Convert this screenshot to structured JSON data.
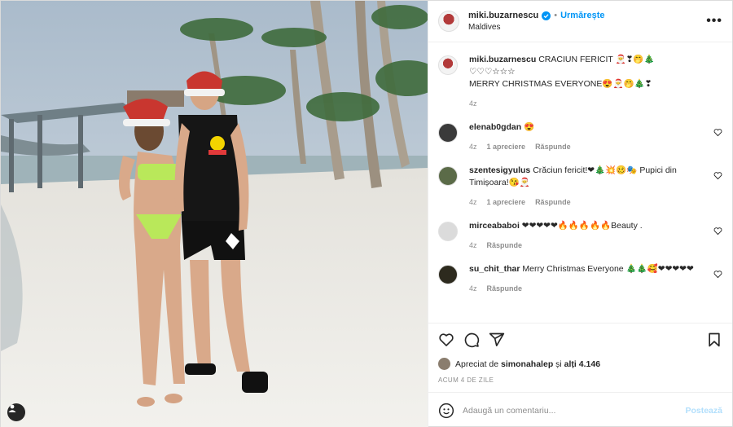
{
  "header": {
    "username": "miki.buzarnescu",
    "follow_label": "Urmărește",
    "location": "Maldives",
    "more_glyph": "•••"
  },
  "caption": {
    "username": "miki.buzarnescu",
    "line1": "CRACIUN FERICIT 🎅❣🤭🎄",
    "line2": "♡♡♡☆☆☆",
    "line3": "MERRY CHRISTMAS EVERYONE😍🎅🤭🎄❣",
    "time": "4z"
  },
  "comments": [
    {
      "username": "elenab0gdan",
      "text": "😍",
      "time": "4z",
      "likes": "1 apreciere",
      "reply": "Răspunde"
    },
    {
      "username": "szentesigyulus",
      "text": "Crăciun fericit!❤🎄💥🥴🎭 Pupici din Timișoara!😘🎅",
      "time": "4z",
      "likes": "1 apreciere",
      "reply": "Răspunde"
    },
    {
      "username": "mirceababoi",
      "text": "❤❤❤❤❤🔥🔥🔥🔥🔥Beauty .",
      "time": "4z",
      "likes": "",
      "reply": "Răspunde"
    },
    {
      "username": "su_chit_thar",
      "text": "Merry Christmas Everyone 🎄🎄🥰❤❤❤❤❤",
      "time": "4z",
      "likes": "",
      "reply": "Răspunde"
    }
  ],
  "likes": {
    "prefix": "Apreciat de",
    "user": "simonahalep",
    "mid": "și",
    "others": "alți 4.146"
  },
  "timestamp": "ACUM 4 DE ZILE",
  "add_comment": {
    "placeholder": "Adaugă un comentariu...",
    "post_label": "Postează"
  },
  "colors": {
    "accent": "#0095f6",
    "post_disabled": "#b2dffc",
    "muted": "#8e8e8e"
  }
}
